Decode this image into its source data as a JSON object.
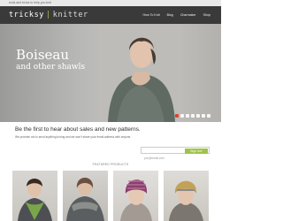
{
  "topbar": {
    "tagline": "tools and tricks to help you knit"
  },
  "logo": {
    "left": "tricksy",
    "right": "knitter"
  },
  "nav": {
    "items": [
      "How To Knit",
      "Blog",
      "Charmaker",
      "Shop"
    ]
  },
  "hero": {
    "title": "Boiseau",
    "subtitle": "and other shawls",
    "slide_count": 7,
    "active_slide": 1
  },
  "newsletter": {
    "heading": "Be the first to hear about sales and new patterns.",
    "subtext": "We promise not to send anything boring and we won't share your email address with anyone.",
    "email_placeholder": "you@email.com",
    "signup_label": "Sign me!"
  },
  "featured": {
    "label": "FEATURED PRODUCTS"
  },
  "colors": {
    "nav_bg": "#3a3a3a",
    "accent_green": "#9fc24a",
    "active_dot": "#d8452f"
  }
}
